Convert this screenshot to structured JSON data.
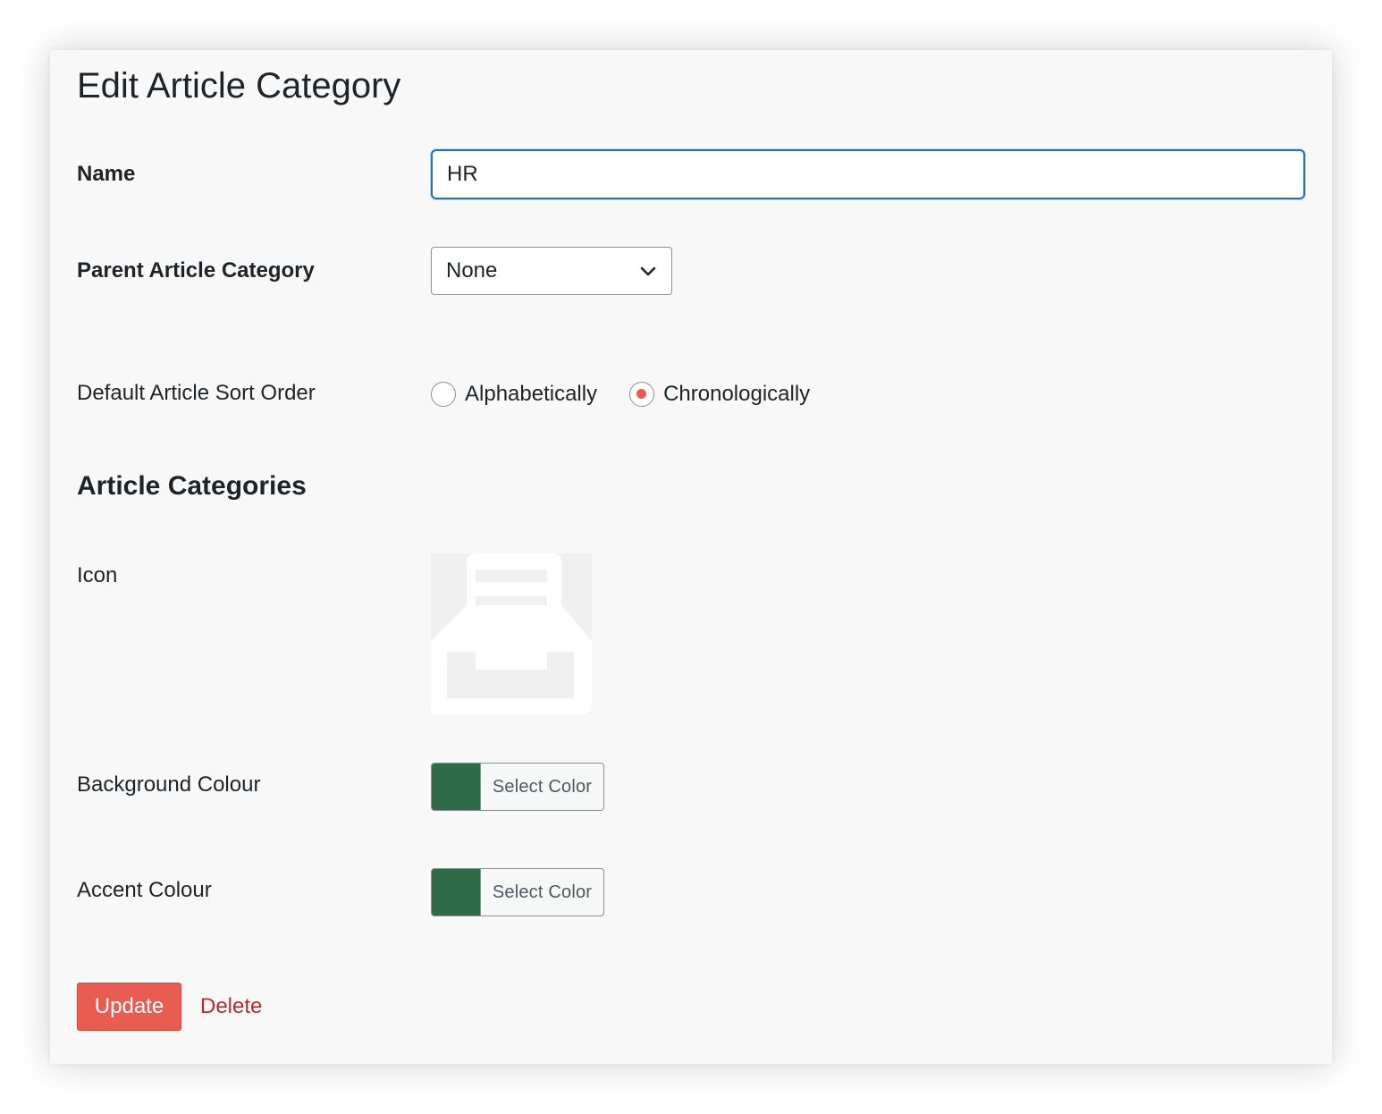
{
  "page": {
    "title": "Edit Article Category"
  },
  "form": {
    "name": {
      "label": "Name",
      "value": "HR"
    },
    "parent": {
      "label": "Parent Article Category",
      "selected": "None"
    },
    "sort_order": {
      "label": "Default Article Sort Order",
      "options": [
        {
          "label": "Alphabetically",
          "checked": false
        },
        {
          "label": "Chronologically",
          "checked": true
        }
      ]
    }
  },
  "article_categories": {
    "heading": "Article Categories",
    "icon": {
      "label": "Icon",
      "preview_icon": "inbox-tray-icon"
    },
    "background_colour": {
      "label": "Background Colour",
      "button_label": "Select Color",
      "color": "#2e6b47"
    },
    "accent_colour": {
      "label": "Accent Colour",
      "button_label": "Select Color",
      "color": "#2e6b47"
    }
  },
  "actions": {
    "update_label": "Update",
    "delete_label": "Delete"
  },
  "colors": {
    "primary_button": "#e85c52",
    "focus_border": "#2271b1",
    "delete_link": "#b32d2e",
    "radio_checked": "#e85c52"
  }
}
